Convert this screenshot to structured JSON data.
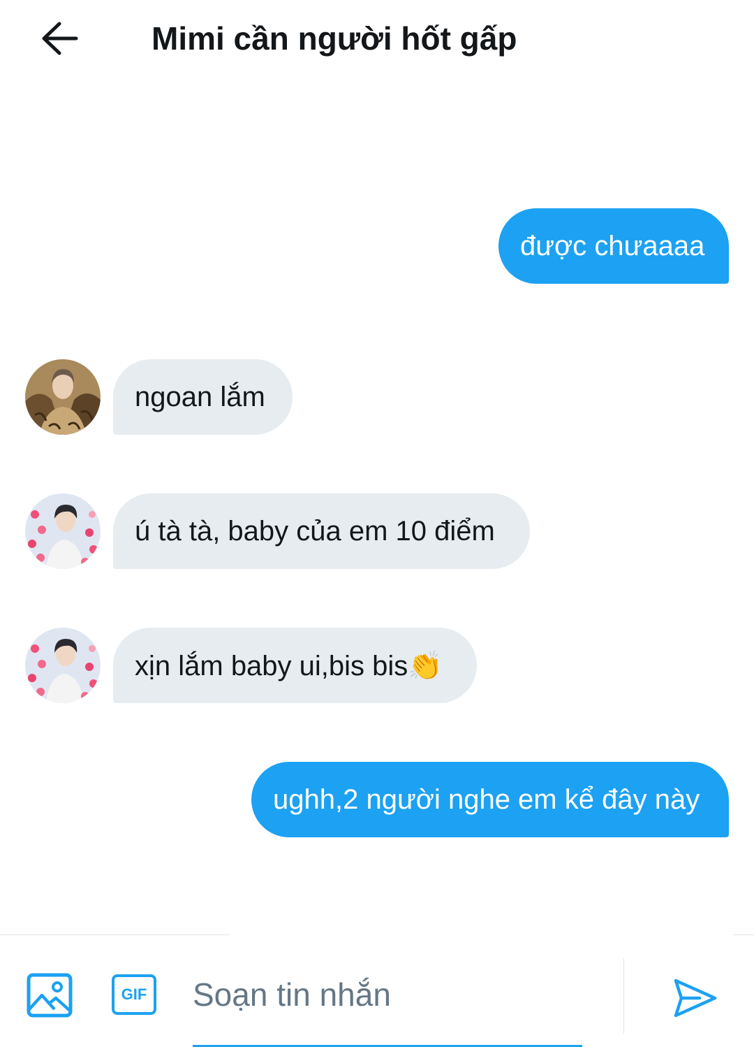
{
  "header": {
    "title": "Mimi cần người hốt gấp"
  },
  "messages": [
    {
      "direction": "sent",
      "text": "được chưaaaa"
    },
    {
      "direction": "received",
      "avatar": "avatar-fur-coat",
      "text": "ngoan lắm"
    },
    {
      "direction": "received",
      "avatar": "avatar-hearts",
      "text": "ú tà tà, baby của em 10 điểm"
    },
    {
      "direction": "received",
      "avatar": "avatar-hearts",
      "text": "xịn lắm baby ui,bis bis👏"
    },
    {
      "direction": "sent",
      "text": "ughh,2 người nghe em kể đây này"
    }
  ],
  "composer": {
    "placeholder": "Soạn tin nhắn",
    "value": "",
    "gif_label": "GIF"
  },
  "colors": {
    "accent": "#1da1f2",
    "sent_bubble": "#1da1f2",
    "received_bubble": "#e6ecf0",
    "text": "#14171a",
    "placeholder": "#657786"
  },
  "icons": {
    "back": "arrow-left-icon",
    "image": "image-icon",
    "gif": "gif-icon",
    "send": "send-icon"
  }
}
